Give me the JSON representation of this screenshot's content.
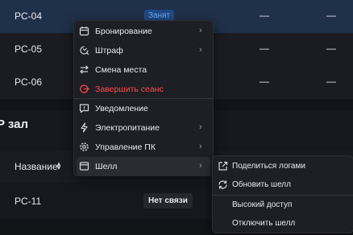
{
  "rows": [
    {
      "name": "PC-04",
      "status": "Занят",
      "col1": "—",
      "col2": "—"
    },
    {
      "name": "PC-05",
      "col1": "—",
      "col2": "—"
    },
    {
      "name": "PC-06",
      "col1": "—",
      "col2": "—"
    }
  ],
  "section": {
    "title": "P зал"
  },
  "table": {
    "column_name": "Название",
    "rows": [
      {
        "name": "PC-11",
        "status": "Нет связи"
      }
    ]
  },
  "context_menu": {
    "items": [
      {
        "label": "Бронирование",
        "icon": "calendar-icon",
        "submenu": true
      },
      {
        "label": "Штраф",
        "icon": "penalty-icon",
        "submenu": true
      },
      {
        "label": "Смена места",
        "icon": "swap-icon",
        "submenu": false
      },
      {
        "label": "Завершить сеанс",
        "icon": "power-icon",
        "submenu": false,
        "danger": true
      },
      {
        "label": "Уведомление",
        "icon": "message-icon",
        "submenu": false
      },
      {
        "label": "Электропитание",
        "icon": "lightning-icon",
        "submenu": true
      },
      {
        "label": "Управление ПК",
        "icon": "gear-icon",
        "submenu": true
      },
      {
        "label": "Шелл",
        "icon": "terminal-icon",
        "submenu": true,
        "active": true
      }
    ],
    "chevron": "›"
  },
  "shell_submenu": {
    "items": [
      {
        "label": "Поделиться логами",
        "icon": "share-icon"
      },
      {
        "label": "Обновить шелл",
        "icon": "refresh-icon"
      },
      {
        "label": "Высокий доступ"
      },
      {
        "label": "Отключить шелл"
      }
    ]
  },
  "colors": {
    "danger": "#ff4a4a",
    "busy_badge_bg": "#1f4b86",
    "busy_badge_text": "#6fa8f0",
    "selected_row": "#1f3049"
  }
}
